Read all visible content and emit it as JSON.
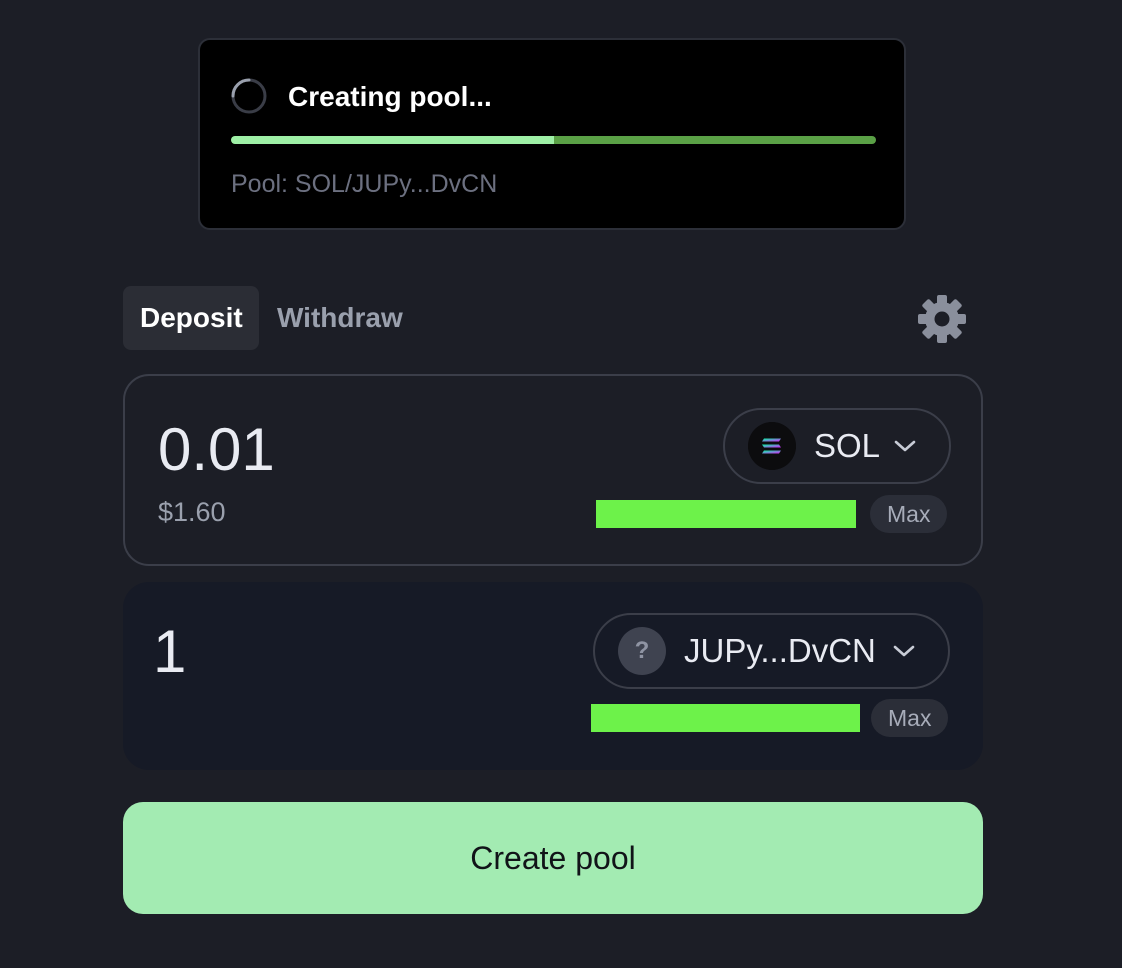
{
  "toast": {
    "title": "Creating pool...",
    "progress_fraction": 0.5,
    "subtitle": "Pool: SOL/JUPy...DvCN"
  },
  "tabs": [
    {
      "label": "Deposit",
      "active": true
    },
    {
      "label": "Withdraw",
      "active": false
    }
  ],
  "inputs": [
    {
      "amount": "0.01",
      "usd_value": "$1.60",
      "token": "SOL",
      "token_icon": "solana-icon",
      "max_label": "Max"
    },
    {
      "amount": "1",
      "usd_value": "",
      "token": "JUPy...DvCN",
      "token_icon": "unknown-token-icon",
      "token_icon_glyph": "?",
      "max_label": "Max"
    }
  ],
  "primary_button": {
    "label": "Create pool"
  },
  "colors": {
    "background": "#1c1e26",
    "accent": "#a3ebb2",
    "progress": "#9ef0a6",
    "redaction": "#6df24a"
  }
}
